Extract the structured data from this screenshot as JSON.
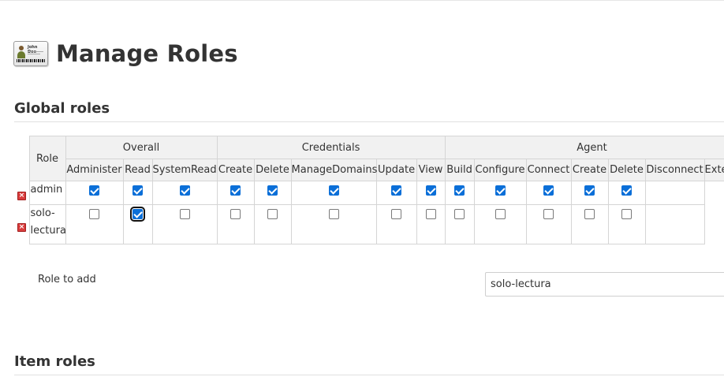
{
  "page": {
    "title": "Manage Roles",
    "icon": "id-card-icon"
  },
  "global_roles": {
    "heading": "Global roles",
    "role_column_label": "Role",
    "groups": [
      {
        "label": "Overall",
        "permissions": [
          "Administer",
          "Read",
          "SystemRead"
        ]
      },
      {
        "label": "Credentials",
        "permissions": [
          "Create",
          "Delete",
          "ManageDomains",
          "Update",
          "View"
        ]
      },
      {
        "label": "Agent",
        "permissions": [
          "Build",
          "Configure",
          "Connect",
          "Create",
          "Delete",
          "Disconnect",
          "Exte"
        ]
      }
    ],
    "rows": [
      {
        "name": "admin",
        "delete_icon": "delete-icon",
        "checks": [
          true,
          true,
          true,
          true,
          true,
          true,
          true,
          true,
          true,
          true,
          true,
          true,
          true,
          true
        ]
      },
      {
        "name": "solo-lectura",
        "delete_icon": "delete-icon",
        "checks": [
          false,
          true,
          false,
          false,
          false,
          false,
          false,
          false,
          false,
          false,
          false,
          false,
          false,
          false
        ],
        "focused_index": 1
      }
    ]
  },
  "role_to_add": {
    "label": "Role to add",
    "value": "solo-lectura"
  },
  "item_roles": {
    "heading": "Item roles"
  },
  "colors": {
    "checkbox_checked": "#0b6fd8",
    "header_bg": "#f1f1f1",
    "delete_icon": "#d93c3c"
  }
}
